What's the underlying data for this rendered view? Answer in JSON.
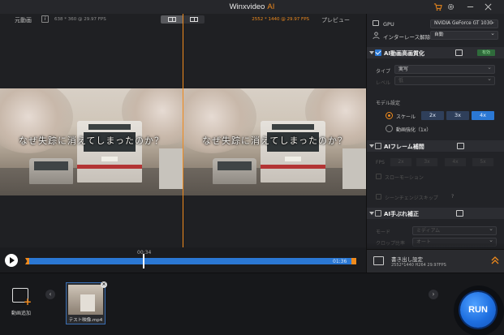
{
  "app": {
    "title": "Winxvideo",
    "title_suffix": "AI"
  },
  "preview": {
    "original_label": "元動画",
    "info_button": "i",
    "source_info": "638 * 360 @ 29.97 FPS",
    "output_info": "2552 * 1440 @ 29.97 FPS",
    "preview_label": "プレビュー",
    "subtitle": "なぜ失踪に消えてしまったのか？"
  },
  "player": {
    "current_time": "00:34",
    "end_time": "01:36",
    "progress": 0.36
  },
  "panel": {
    "gpu_label": "GPU",
    "gpu_value": "NVIDIA GeForce GT 1030",
    "deinterlace_label": "インターレース解除",
    "deinterlace_value": "自動",
    "upscale": {
      "title": "AI動画高画質化",
      "badge": "有効",
      "type_label": "タイプ",
      "type_value": "実写",
      "level_label": "レベル",
      "level_value": "低",
      "model_label": "モデル設定",
      "scale_label": "スケール",
      "scale_options": [
        "2x",
        "3x",
        "4x"
      ],
      "selected_scale": "4x",
      "enhance_label": "動画強化（1x）"
    },
    "frame_interp": {
      "title": "AIフレーム補間",
      "fps_label": "FPS",
      "fps_options": [
        "2x",
        "3x",
        "4x",
        "5x"
      ],
      "slowmo_label": "スローモーション",
      "scene_label": "シーンチェンジスキップ",
      "help": "?"
    },
    "stabilize": {
      "title": "AI手ぶれ補正",
      "mode_label": "モード",
      "mode_value": "ミディアム",
      "crop_label": "クロップ比率",
      "crop_value": "オート"
    },
    "export": {
      "title": "書き出し設定",
      "info": "2552*1440  H264  29.97FPS"
    }
  },
  "bottom": {
    "add_video_label": "動画追加",
    "file_name": "テスト映像.mp4",
    "run_label": "RUN"
  },
  "colors": {
    "accent": "#f08a1c",
    "blue": "#2b78d4",
    "badge": "#2f6b3b"
  }
}
